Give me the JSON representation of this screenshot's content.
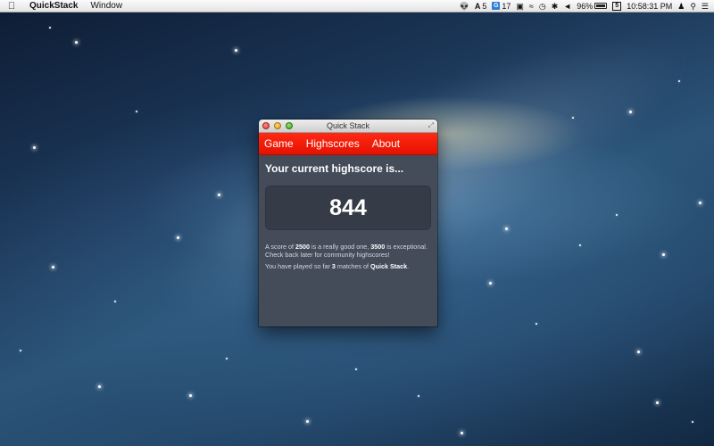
{
  "menubar": {
    "apple_icon": "apple-icon",
    "app_name": "QuickStack",
    "menus": [
      "Window"
    ],
    "status": {
      "adobe_count": "5",
      "g_count": "17",
      "battery_percent": "96%",
      "clock": "10:58:31 PM"
    }
  },
  "window": {
    "title": "Quick Stack",
    "nav": [
      "Game",
      "Highscores",
      "About"
    ],
    "heading": "Your current highscore is...",
    "score": "844",
    "info1": {
      "t1": "A score of ",
      "v1": "2500",
      "t2": " is a really good one, ",
      "v2": "3500",
      "t3": " is exceptional. Check back later for community highscores!"
    },
    "info2": {
      "t1": "You have played so far ",
      "v1": "3",
      "t2": " matches of ",
      "v2": "Quick Stack",
      "t3": "."
    }
  },
  "colors": {
    "nav_bar": "#ff2a14",
    "window_bg": "#444b59",
    "score_box": "#363b48"
  }
}
